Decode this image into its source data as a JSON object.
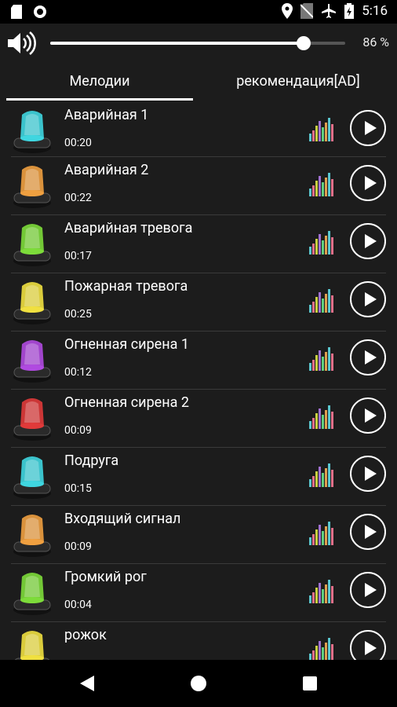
{
  "status_bar": {
    "time": "5:16",
    "icons": [
      "sd-card-icon",
      "circle-icon",
      "location-icon",
      "no-sim-icon",
      "airplane-icon",
      "battery-charging-icon"
    ]
  },
  "volume": {
    "percent": 86,
    "label": "86 %"
  },
  "tabs": [
    {
      "label": "Мелодии",
      "selected": true
    },
    {
      "label": "рекомендация[AD]",
      "selected": false
    }
  ],
  "items": [
    {
      "title": "Аварийная 1",
      "duration": "00:20",
      "color": "#3fd6e0"
    },
    {
      "title": "Аварийная 2",
      "duration": "00:22",
      "color": "#f0a040"
    },
    {
      "title": "Аварийная тревога",
      "duration": "00:17",
      "color": "#7ddc3a"
    },
    {
      "title": "Пожарная тревога",
      "duration": "00:25",
      "color": "#f0e040"
    },
    {
      "title": "Огненная сирена 1",
      "duration": "00:12",
      "color": "#b04ae0"
    },
    {
      "title": "Огненная сирена 2",
      "duration": "00:09",
      "color": "#e03a3a"
    },
    {
      "title": "Подруга",
      "duration": "00:15",
      "color": "#3fd6e0"
    },
    {
      "title": "Входящий сигнал",
      "duration": "00:09",
      "color": "#f0a040"
    },
    {
      "title": "Громкий рог",
      "duration": "00:04",
      "color": "#7ddc3a"
    },
    {
      "title": "рожок",
      "duration": "",
      "color": "#f0e040"
    }
  ],
  "navbar": {
    "icons": [
      "back-icon",
      "home-icon",
      "recents-icon"
    ]
  }
}
